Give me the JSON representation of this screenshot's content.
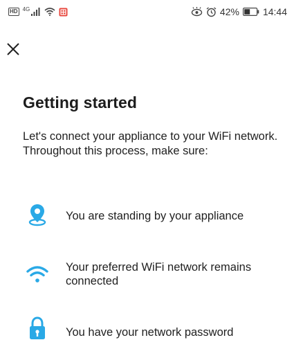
{
  "status_bar": {
    "hd_label": "HD",
    "network_label": "4G",
    "battery_percent": "42%",
    "time": "14:44",
    "icons": [
      "hd-badge-icon",
      "signal-icon",
      "wifi-icon",
      "app-notification-icon",
      "eye-care-icon",
      "alarm-icon",
      "battery-icon"
    ]
  },
  "header": {
    "close_icon": "close-icon"
  },
  "content": {
    "title": "Getting started",
    "intro": "Let's connect your appliance to your WiFi network. Throughout this process, make sure:"
  },
  "requirements": [
    {
      "icon": "location-pin-icon",
      "label": "You are standing by your appliance"
    },
    {
      "icon": "wifi-icon",
      "label": "Your preferred WiFi network remains connected"
    },
    {
      "icon": "lock-icon",
      "label": "You have your network password"
    }
  ],
  "colors": {
    "accent": "#2aa9e6",
    "text": "#1f1f1f",
    "background": "#ffffff"
  }
}
